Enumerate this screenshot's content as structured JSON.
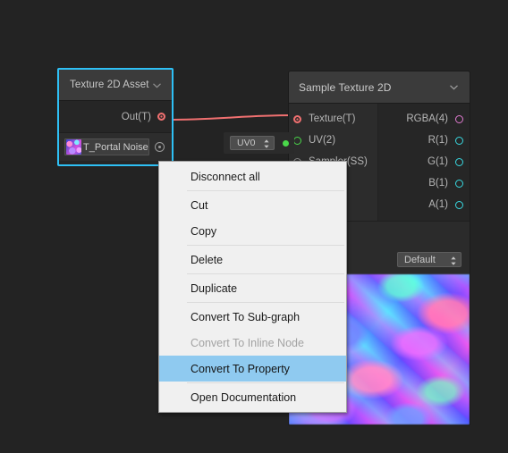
{
  "canvas": {
    "background_color": "#232323"
  },
  "nodes": {
    "texture_asset": {
      "title": "Texture 2D Asset",
      "collapse_icon": "chevron-down-icon",
      "output_port_label": "Out(T)",
      "output_port_color": "#f07070",
      "asset_field": {
        "value": "T_Portal Noise",
        "thumbnail_icon": "texture-thumbnail-icon",
        "picker_icon": "object-picker-target-icon"
      },
      "selection_border_color": "#2ec0f5"
    },
    "sample_texture": {
      "title": "Sample Texture 2D",
      "collapse_icon": "chevron-down-icon",
      "inputs": [
        {
          "label": "Texture(T)",
          "port_style": "filled",
          "color": "#f07070"
        },
        {
          "label": "UV(2)",
          "port_style": "hollow",
          "color": "#4ad84a"
        },
        {
          "label": "Sampler(SS)",
          "port_style": "hollow",
          "color": "#8a8a8a"
        }
      ],
      "outputs": [
        {
          "label": "RGBA(4)",
          "port_style": "hollow",
          "color": "#e07ad0"
        },
        {
          "label": "R(1)",
          "port_style": "hollow",
          "color": "#38d8e0"
        },
        {
          "label": "G(1)",
          "port_style": "hollow",
          "color": "#38d8e0"
        },
        {
          "label": "B(1)",
          "port_style": "hollow",
          "color": "#38d8e0"
        },
        {
          "label": "A(1)",
          "port_style": "hollow",
          "color": "#38d8e0"
        }
      ],
      "type_dropdown": {
        "value": "Default",
        "stepper_icon": "up-down-arrows-icon"
      },
      "preview_label": "texture-preview"
    }
  },
  "uv_widget": {
    "dropdown_value": "UV0",
    "stepper_icon": "up-down-arrows-icon",
    "dot_color": "#4ad84a"
  },
  "wires": [
    {
      "name": "texture-out-to-sample-texture-in",
      "color": "#f07070"
    },
    {
      "name": "uv-widget-to-uv-input",
      "color": "#4ad84a"
    }
  ],
  "context_menu": {
    "highlighted_item": "Convert To Property",
    "items": [
      {
        "label": "Disconnect all",
        "disabled": false,
        "highlighted": false,
        "separator_after": true
      },
      {
        "label": "Cut",
        "disabled": false,
        "highlighted": false,
        "separator_after": false
      },
      {
        "label": "Copy",
        "disabled": false,
        "highlighted": false,
        "separator_after": true
      },
      {
        "label": "Delete",
        "disabled": false,
        "highlighted": false,
        "separator_after": true
      },
      {
        "label": "Duplicate",
        "disabled": false,
        "highlighted": false,
        "separator_after": true
      },
      {
        "label": "Convert To Sub-graph",
        "disabled": false,
        "highlighted": false,
        "separator_after": false
      },
      {
        "label": "Convert To Inline Node",
        "disabled": true,
        "highlighted": false,
        "separator_after": false
      },
      {
        "label": "Convert To Property",
        "disabled": false,
        "highlighted": true,
        "separator_after": true
      },
      {
        "label": "Open Documentation",
        "disabled": false,
        "highlighted": false,
        "separator_after": false
      }
    ]
  }
}
